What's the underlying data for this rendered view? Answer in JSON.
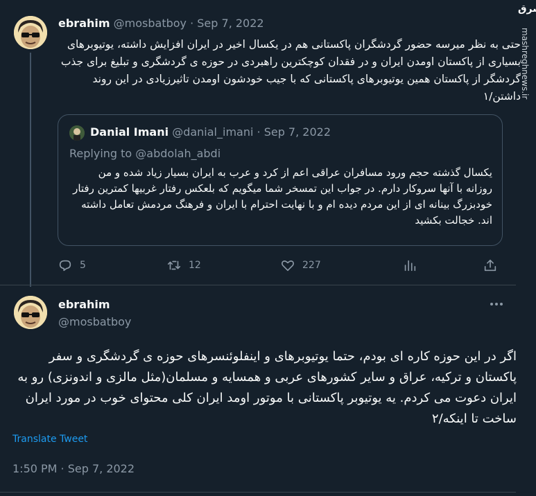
{
  "tweet1": {
    "author_name": "ebrahim",
    "author_handle": "@mosbatboy",
    "date": "· Sep 7, 2022",
    "text": "حتی به نظر میرسه حضور گردشگران پاکستانی هم در یکسال اخیر در ایران افزایش داشته، یوتیوبرهای بسیاری از پاکستان اومدن ایران و در فقدان کوچکترین راهبردی در حوزه ی گردشگری و تبلیغ برای جذب گردشگر از پاکستان همین یوتیوبرهای پاکستانی که با جیب خودشون اومدن تاثیرزیادی در این روند داشتن/۱",
    "quote": {
      "author_name": "Danial Imani",
      "author_handle": "@danial_imani",
      "date": "· Sep 7, 2022",
      "replying_to": "Replying to @abdolah_abdi",
      "text": "یکسال گذشته حجم ورود مسافران عراقی اعم از کرد و عرب به ایران بسیار زیاد شده و من روزانه با آنها سروکار دارم. در جواب این تمسخر شما میگویم که بلعکس رفتار غربیها کمترین رفتار خودبزرگ بینانه ای از این مردم دیده ام و با نهایت احترام با ایران و فرهنگ مردمش تعامل داشته اند. خجالت بکشید"
    },
    "actions": {
      "replies": "5",
      "retweets": "12",
      "likes": "227"
    }
  },
  "tweet2": {
    "author_name": "ebrahim",
    "author_handle": "@mosbatboy",
    "text": "اگر در این حوزه کاره ای بودم، حتما یوتیوبرهای و اینفلوئنسرهای حوزه ی گردشگری و سفر پاکستان و ترکیه، عراق و سایر کشورهای عربی و همسایه و مسلمان(مثل مالزی و اندونزی) رو به ایران دعوت می کردم. یه یوتیوبر پاکستانی با موتور اومد ایران کلی محتوای خوب در مورد ایران ساخت تا اینکه/۲",
    "translate_label": "Translate Tweet",
    "timestamp": "1:50 PM · Sep 7, 2022"
  },
  "watermark": {
    "logo_text": "مشرق",
    "url": "mashreghnews.ir"
  },
  "colors": {
    "background": "#15202b",
    "text": "#f7f9f9",
    "muted": "#8b98a5",
    "link": "#1d9bf0",
    "border": "#38444d"
  },
  "icons": [
    "reply-icon",
    "retweet-icon",
    "like-icon",
    "views-icon",
    "share-icon",
    "more-icon"
  ]
}
